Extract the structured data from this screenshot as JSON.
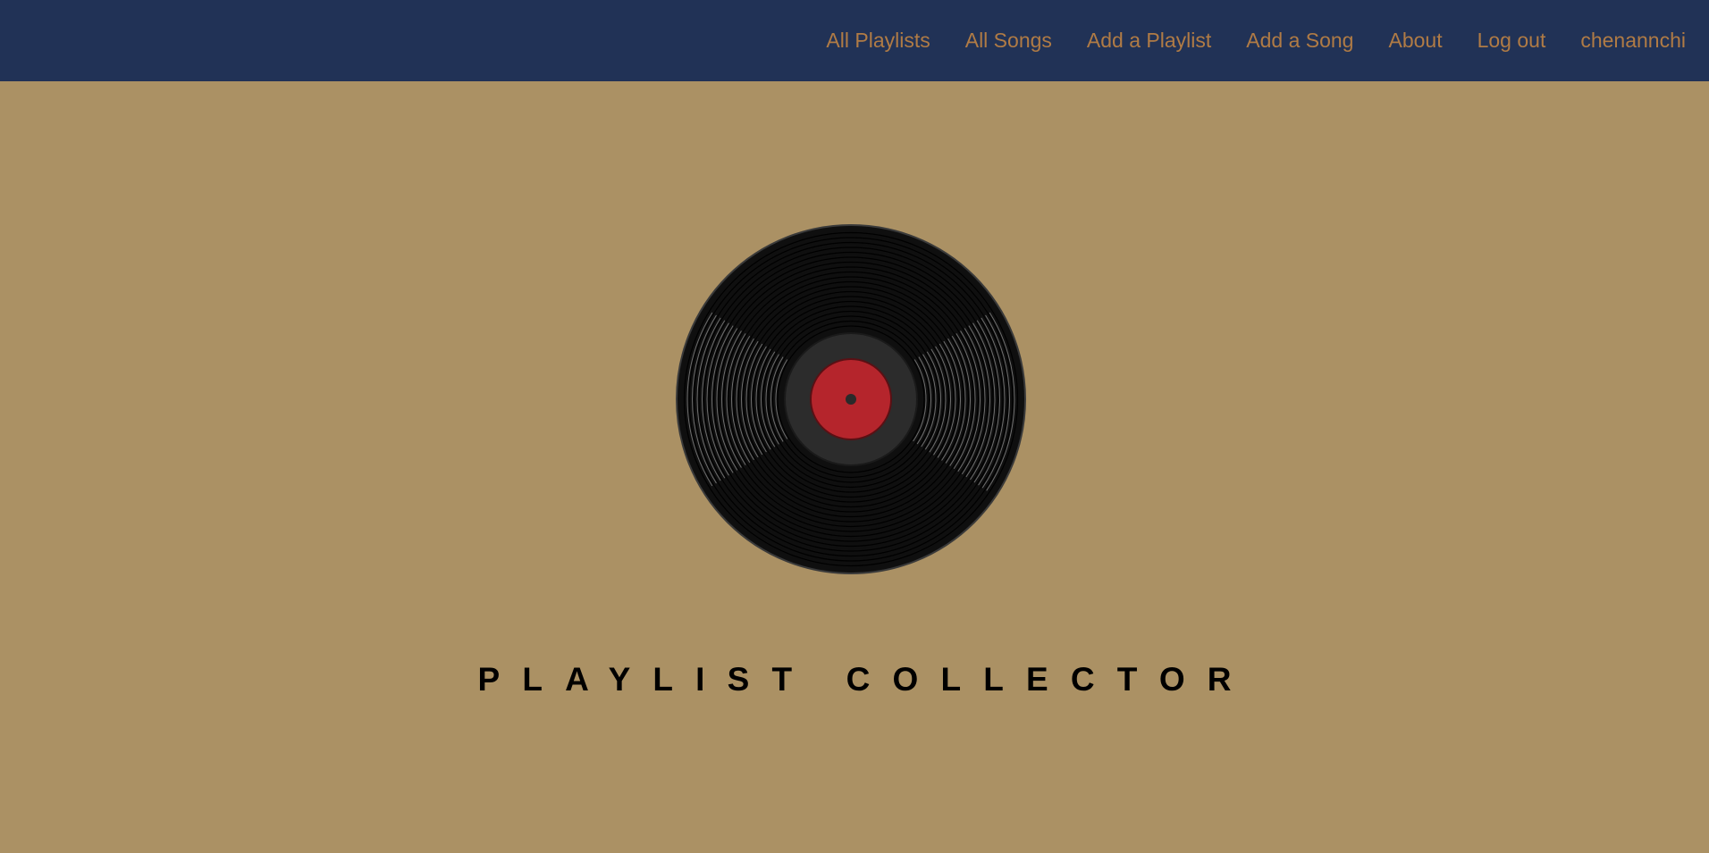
{
  "nav": {
    "items": [
      {
        "label": "All Playlists"
      },
      {
        "label": "All Songs"
      },
      {
        "label": "Add a Playlist"
      },
      {
        "label": "Add a Song"
      },
      {
        "label": "About"
      },
      {
        "label": "Log out"
      },
      {
        "label": "chenannchi"
      }
    ]
  },
  "hero": {
    "icon": "vinyl-record",
    "title": "PLAYLIST COLLECTOR"
  },
  "colors": {
    "navbar_bg": "#213256",
    "nav_link": "#b07b45",
    "page_bg": "#ab9164",
    "record": "#111111",
    "label": "#b5252c"
  }
}
